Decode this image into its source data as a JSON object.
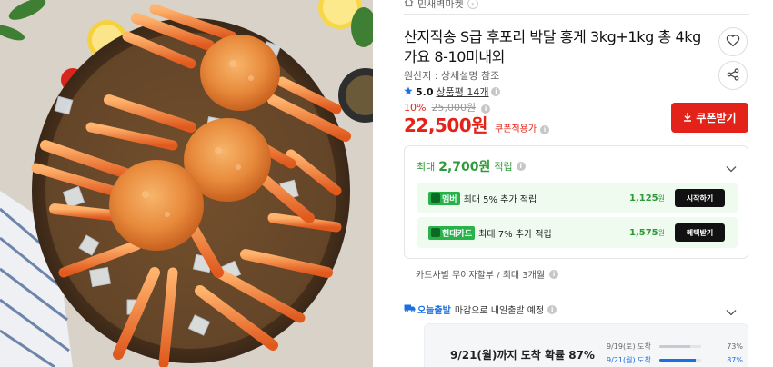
{
  "store": {
    "name": "민새벽마켓"
  },
  "product": {
    "title": "산지직송 S급 후포리 박달 홍게 3kg+1kg 총 4kg 가요 8-10미내외",
    "origin": "원산지 : 상세설명 참조",
    "rating": "5.0",
    "reviews": "상품평 14개",
    "discount_rate": "10%",
    "original_price": "25,000원",
    "price": "22,500원",
    "price_note": "쿠폰적용가"
  },
  "actions": {
    "coupon": "쿠폰받기"
  },
  "icons": {
    "store": "house-icon",
    "favorite": "heart-icon",
    "share": "share-icon",
    "info": "info-icon",
    "star": "star-icon",
    "download": "download-icon",
    "chevron": "chevron-down-icon",
    "card": "card-icon",
    "truck": "truck-icon"
  },
  "reward": {
    "prefix": "최대",
    "amount": "2,700원",
    "label": "적립",
    "benefits": [
      {
        "tag": "멤버",
        "desc": "최대 5% 추가 적립",
        "points": "1,125",
        "unit": "원",
        "action": "시작하기"
      },
      {
        "tag": "현대카드",
        "desc": "최대 7% 추가 적립",
        "points": "1,575",
        "unit": "원",
        "action": "혜택받기"
      }
    ]
  },
  "installment": "카드사별 무이자할부 / 최대 3개월",
  "shipping": {
    "badge": "오늘출발",
    "text": "마감으로 내일출발 예정",
    "headline": "9/21(월)까지 도착 확률 87%",
    "probabilities": [
      {
        "date": "9/19(토) 도착",
        "value": 0.73,
        "label": "73%"
      },
      {
        "date": "9/21(월) 도착",
        "value": 0.87,
        "label": "87%"
      }
    ]
  },
  "colors": {
    "accent": "#e32219",
    "reward": "#2f9a3a",
    "shipping": "#1b6fe0"
  }
}
